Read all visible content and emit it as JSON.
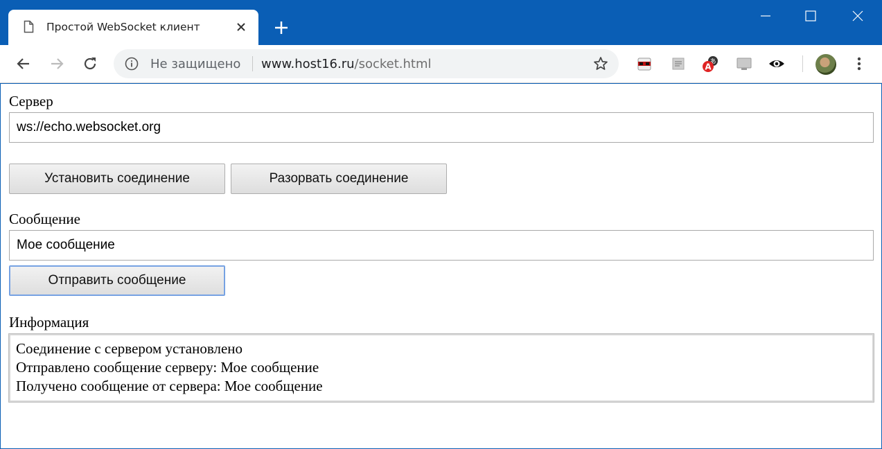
{
  "browser": {
    "tab_title": "Простой WebSocket клиент",
    "omnibox": {
      "security_label": "Не защищено",
      "url_host": "www.host16.ru",
      "url_path": "/socket.html"
    },
    "icons": {
      "tab": "document-icon",
      "close_tab": "close-icon",
      "new_tab": "plus-icon",
      "back": "arrow-left-icon",
      "forward": "arrow-right-icon",
      "reload": "reload-icon",
      "info": "info-icon",
      "bookmark": "star-icon",
      "menu": "kebab-menu-icon"
    },
    "colors": {
      "titlebar": "#0a5eb5",
      "omnibox_bg": "#f1f3f4"
    }
  },
  "page": {
    "server": {
      "label": "Сервер",
      "value": "ws://echo.websocket.org"
    },
    "buttons": {
      "connect": "Установить соединение",
      "disconnect": "Разорвать соединение",
      "send": "Отправить сообщение"
    },
    "message": {
      "label": "Сообщение",
      "value": "Мое сообщение"
    },
    "info": {
      "label": "Информация",
      "lines": [
        "Соединение с сервером установлено",
        "Отправлено сообщение серверу: Мое сообщение",
        "Получено сообщение от сервера: Мое сообщение"
      ]
    }
  }
}
